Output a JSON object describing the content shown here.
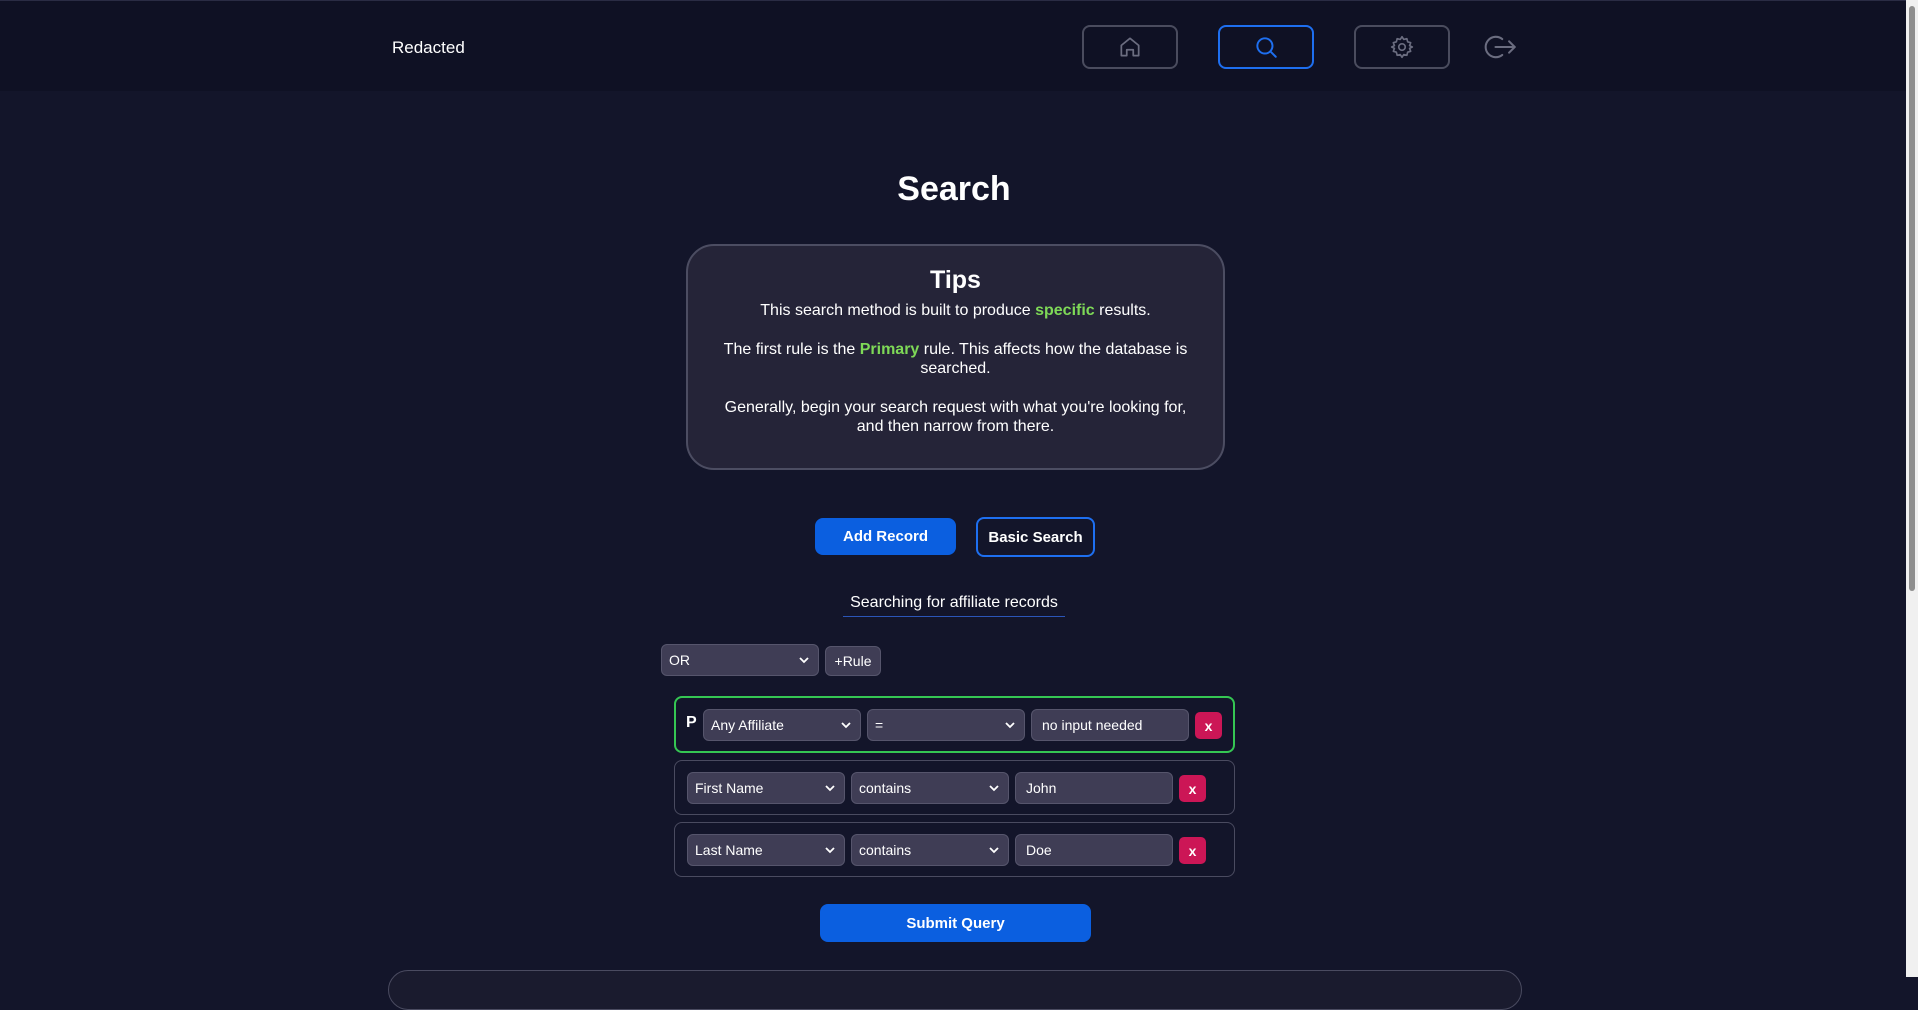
{
  "header": {
    "brand": "Redacted",
    "nav": [
      {
        "name": "home-icon",
        "active": false
      },
      {
        "name": "search-icon",
        "active": true
      },
      {
        "name": "gear-icon",
        "active": false
      },
      {
        "name": "logout-icon",
        "active": false
      }
    ]
  },
  "page": {
    "title": "Search"
  },
  "tips": {
    "title": "Tips",
    "line1_pre": "This search method is built to produce ",
    "line1_hl": "specific",
    "line1_post": " results.",
    "line2_pre": "The first rule is the ",
    "line2_hl": "Primary",
    "line2_post": " rule. This affects how the database is searched.",
    "line3": "Generally, begin your search request with what you're looking for, and then narrow from there."
  },
  "actions": {
    "add_record": "Add Record",
    "basic_search": "Basic Search",
    "submit": "Submit Query"
  },
  "query": {
    "searching_label": "Searching for affiliate records",
    "combinator": "OR",
    "add_rule": "+Rule",
    "primary_marker": "P",
    "delete_label": "x",
    "rules": [
      {
        "field": "Any Affiliate",
        "operator": "=",
        "value": "no input needed"
      },
      {
        "field": "First Name",
        "operator": "contains",
        "value": "John"
      },
      {
        "field": "Last Name",
        "operator": "contains",
        "value": "Doe"
      }
    ]
  },
  "colors": {
    "background": "#13152a",
    "accent": "#0b5fe0",
    "highlight": "#7ed957",
    "primary_border": "#35c653",
    "danger": "#cc1656"
  }
}
